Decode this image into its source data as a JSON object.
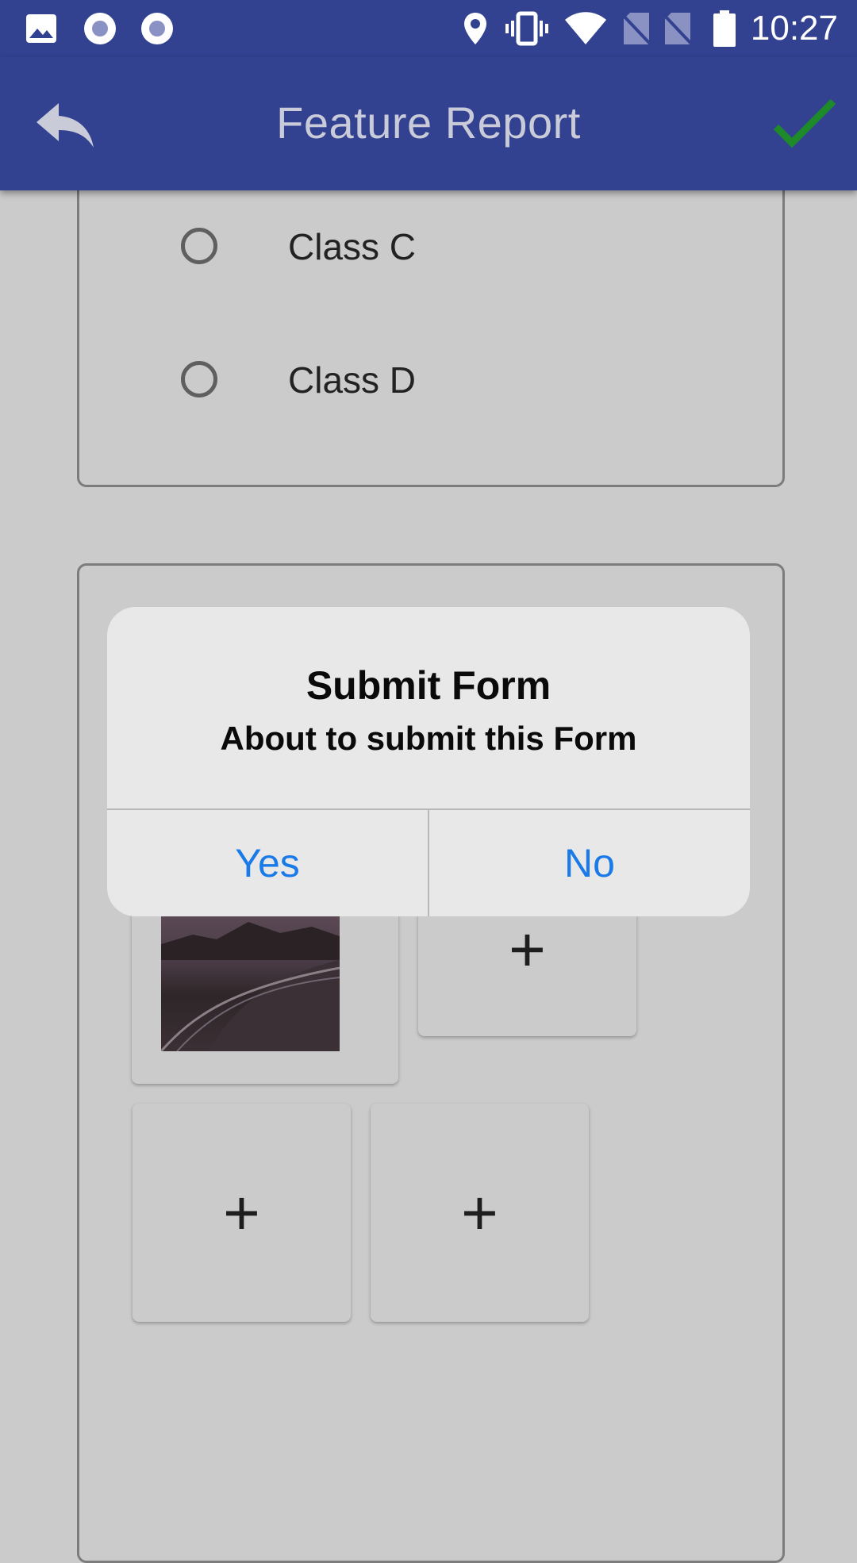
{
  "status_bar": {
    "time": "10:27",
    "icons": [
      "image-icon",
      "record-icon",
      "record-icon",
      "location-icon",
      "vibrate-icon",
      "wifi-icon",
      "no-sim-icon",
      "no-sim-icon",
      "battery-icon"
    ]
  },
  "app_bar": {
    "title": "Feature Report",
    "back_icon": "reply-icon",
    "confirm_icon": "check-icon",
    "confirm_color": "#1e8a2a"
  },
  "form": {
    "radio_options": [
      {
        "label": "Class C",
        "selected": false
      },
      {
        "label": "Class D",
        "selected": false
      }
    ],
    "photo_tiles": {
      "add_symbol": "+"
    }
  },
  "dialog": {
    "title": "Submit Form",
    "message": "About to submit this Form",
    "yes_label": "Yes",
    "no_label": "No",
    "button_color": "#1a7ae8"
  },
  "colors": {
    "primary": "#334191",
    "background": "#cbcbcb"
  }
}
